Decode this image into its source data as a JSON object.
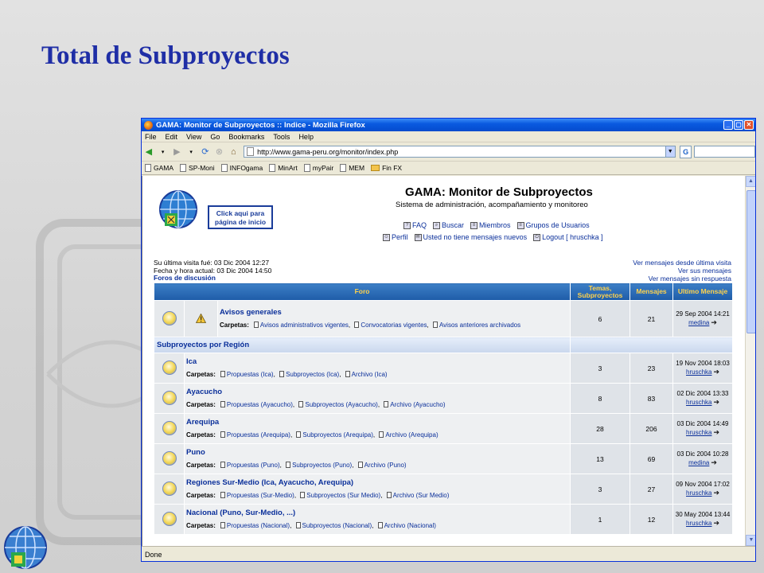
{
  "slide": {
    "title": "Total de Subproyectos"
  },
  "browser": {
    "window_title": "GAMA: Monitor de Subproyectos :: Indice - Mozilla Firefox",
    "menu": [
      "File",
      "Edit",
      "View",
      "Go",
      "Bookmarks",
      "Tools",
      "Help"
    ],
    "address": "http://www.gama-peru.org/monitor/index.php",
    "bookmarks": [
      {
        "label": "GAMA",
        "type": "page"
      },
      {
        "label": "SP-Moni",
        "type": "page"
      },
      {
        "label": "INFOgama",
        "type": "page"
      },
      {
        "label": "MinArt",
        "type": "page"
      },
      {
        "label": "myPair",
        "type": "page"
      },
      {
        "label": "MEM",
        "type": "page"
      },
      {
        "label": "Fin FX",
        "type": "folder"
      }
    ],
    "status": "Done"
  },
  "site": {
    "home_link": "Click aqui para página de inicio",
    "title": "GAMA: Monitor de Subproyectos",
    "description": "Sistema de administración, acompañamiento y monitoreo",
    "links_row1": [
      "FAQ",
      "Buscar",
      "Miembros",
      "Grupos de Usuarios"
    ],
    "links_row2": [
      "Perfil",
      "Usted no tiene mensajes nuevos",
      "Logout [ hruschka ]"
    ],
    "last_visit": "Su última visita fué: 03 Dic 2004 12:27",
    "current_time": "Fecha y hora actual: 03 Dic 2004 14:50",
    "forums_link": "Foros de discusión",
    "right_links": [
      "Ver mensajes desde última visita",
      "Ver sus mensajes",
      "Ver mensajes sin respuesta"
    ]
  },
  "table": {
    "headers": {
      "foro": "Foro",
      "temas": "Temas, Subproyectos",
      "mensajes": "Mensajes",
      "ultimo": "Ultimo Mensaje"
    },
    "carpetas_label": "Carpetas:",
    "general": {
      "name": "Avisos generales",
      "folders": [
        "Avisos administrativos vigentes",
        "Convocatorias vigentes",
        "Avisos anteriores archivados"
      ],
      "temas": "6",
      "mensajes": "21",
      "last_date": "29 Sep 2004 14:21",
      "last_user": "medina"
    },
    "category": "Subproyectos por Región",
    "regions": [
      {
        "name": "Ica",
        "folders": [
          "Propuestas (Ica)",
          "Subproyectos (Ica)",
          "Archivo (Ica)"
        ],
        "temas": "3",
        "mensajes": "23",
        "last_date": "19 Nov 2004 18:03",
        "last_user": "hruschka"
      },
      {
        "name": "Ayacucho",
        "folders": [
          "Propuestas (Ayacucho)",
          "Subproyectos (Ayacucho)",
          "Archivo (Ayacucho)"
        ],
        "temas": "8",
        "mensajes": "83",
        "last_date": "02 Dic 2004 13:33",
        "last_user": "hruschka"
      },
      {
        "name": "Arequipa",
        "folders": [
          "Propuestas (Arequipa)",
          "Subproyectos (Arequipa)",
          "Archivo (Arequipa)"
        ],
        "temas": "28",
        "mensajes": "206",
        "last_date": "03 Dic 2004 14:49",
        "last_user": "hruschka"
      },
      {
        "name": "Puno",
        "folders": [
          "Propuestas (Puno)",
          "Subproyectos (Puno)",
          "Archivo (Puno)"
        ],
        "temas": "13",
        "mensajes": "69",
        "last_date": "03 Dic 2004 10:28",
        "last_user": "medina"
      },
      {
        "name": "Regiones Sur-Medio (Ica, Ayacucho, Arequipa)",
        "folders": [
          "Propuestas (Sur-Medio)",
          "Subproyectos (Sur Medio)",
          "Archivo (Sur Medio)"
        ],
        "temas": "3",
        "mensajes": "27",
        "last_date": "09 Nov 2004 17:02",
        "last_user": "hruschka"
      },
      {
        "name": "Nacional (Puno, Sur-Medio, ...)",
        "folders": [
          "Propuestas (Nacional)",
          "Subproyectos (Nacional)",
          "Archivo (Nacional)"
        ],
        "temas": "1",
        "mensajes": "12",
        "last_date": "30 May 2004 13:44",
        "last_user": "hruschka"
      }
    ]
  }
}
